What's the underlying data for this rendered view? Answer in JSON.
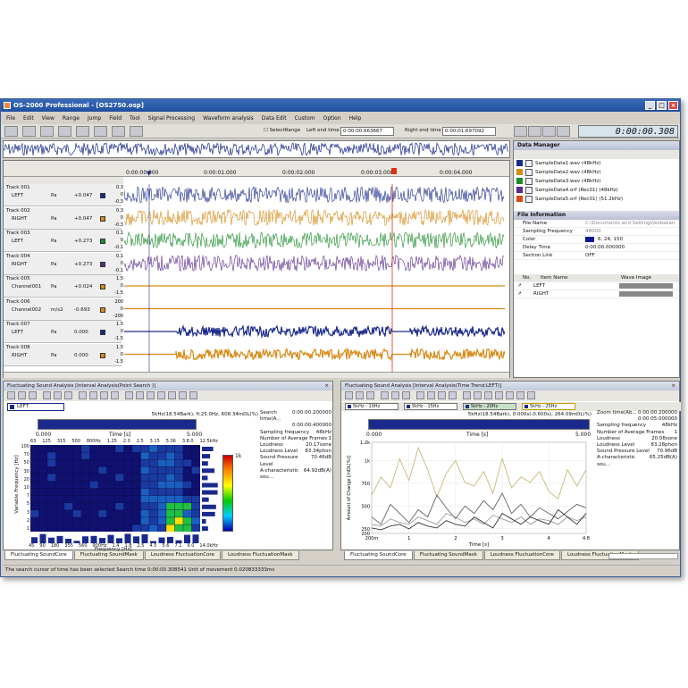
{
  "window": {
    "title": "OS-2000 Professional - [OS2750.osp]"
  },
  "menu": [
    "File",
    "Edit",
    "View",
    "Range",
    "Jump",
    "Field",
    "Tool",
    "Signal Processing",
    "Waveform analysis",
    "Data Edit",
    "Custom",
    "Option",
    "Help"
  ],
  "toolbar": {
    "select_range": "SelectRange",
    "left_end_label": "Left end time",
    "left_end_value": "0:00:00.663667",
    "right_end_label": "Right end time",
    "right_end_value": "0:00:01.697092",
    "clock": "0:00:00.308"
  },
  "timeline": {
    "ticks": [
      "0:00:00.000",
      "0:00:01.000",
      "0:00:02.000",
      "0:00:03.000",
      "0:00:04.000"
    ]
  },
  "tracks": [
    {
      "name": "Track 001",
      "channel": "LEFT",
      "unit": "Pa",
      "value": "+0.047",
      "color": "#1a2a8c",
      "scale": [
        "0.3",
        "0",
        "-0.3"
      ]
    },
    {
      "name": "Track 002",
      "channel": "RIGHT",
      "unit": "Pa",
      "value": "+0.047",
      "color": "#d88a14",
      "scale": [
        "0.3",
        "0",
        "-0.3"
      ]
    },
    {
      "name": "Track 003",
      "channel": "LEFT",
      "unit": "Pa",
      "value": "+0.273",
      "color": "#1a8c2a",
      "scale": [
        "0.1",
        "0",
        "-0.1"
      ]
    },
    {
      "name": "Track 004",
      "channel": "RIGHT",
      "unit": "Pa",
      "value": "+0.273",
      "color": "#5a2a8c",
      "scale": [
        "0.1",
        "0",
        "-0.1"
      ]
    },
    {
      "name": "Track 005",
      "channel": "Channel001",
      "unit": "Pa",
      "value": "+0.024",
      "color": "#d88a14",
      "scale": [
        "1.5",
        "0",
        "-1.5"
      ]
    },
    {
      "name": "Track 006",
      "channel": "Channel002",
      "unit": "m/s2",
      "value": "-0.693",
      "color": "#d88a14",
      "scale": [
        "200",
        "0",
        "-200"
      ]
    },
    {
      "name": "Track 007",
      "channel": "LEFT",
      "unit": "Pa",
      "value": "0.000",
      "color": "#1a2a8c",
      "scale": [
        "1.5",
        "0",
        "-1.5"
      ]
    },
    {
      "name": "Track 008",
      "channel": "RIGHT",
      "unit": "Pa",
      "value": "0.000",
      "color": "#d88a14",
      "scale": [
        "1.5",
        "0",
        "-1.5"
      ]
    }
  ],
  "data_manager": {
    "title": "Data Manager",
    "files": [
      {
        "name": "SampleData1.wav (48kHz)",
        "color": "#1a2a8c"
      },
      {
        "name": "SampleData2.wav (48kHz)",
        "color": "#d88a14"
      },
      {
        "name": "SampleData3.wav (48kHz)",
        "color": "#1a8c2a"
      },
      {
        "name": "SampleData4.orf (Rec01) (48kHz)",
        "color": "#5a2a8c"
      },
      {
        "name": "SampleData5.orf (Rec01) (51.2kHz)",
        "color": "#d84a14"
      }
    ],
    "file_info_title": "File Information",
    "props": [
      {
        "k": "File Name",
        "v": "C:\\Documents and Settings\\kobakan"
      },
      {
        "k": "Sampling Frequency",
        "v": "48000"
      },
      {
        "k": "Color",
        "v": "6, 24, 150"
      },
      {
        "k": "Delay Time",
        "v": "0:00:00.000000"
      },
      {
        "k": "Section Link",
        "v": "OFF"
      }
    ],
    "items_head": {
      "no": "No.",
      "item": "Item Name",
      "wave": "Wave Image"
    },
    "items": [
      "LEFT",
      "RIGHT"
    ]
  },
  "left_panel": {
    "title": "Fluctuating Sound Analysis [Interval Analysis(Point Search )]",
    "channel": "LEFT",
    "header_info": "5kHz(18.54Bark), fi:25.0Hz, 608.34mDL(%)",
    "time_ticks": [
      "0.000",
      "Time [s]",
      "5.000"
    ],
    "freq_top": [
      "63",
      "125",
      "315",
      "500",
      "800Hz",
      "1.25",
      "2.0",
      "2.5",
      "3.15",
      "5.06",
      "3.8.0",
      "12.5kHz"
    ],
    "freq_bottom": [
      "45",
      "90",
      "180",
      "355",
      "560",
      "900Hz",
      "1.4",
      "1.8",
      "2.5",
      "4.5",
      "5.6",
      "7.1",
      "9.0",
      "14.0kHz"
    ],
    "x_label": "Frequency [Hz]",
    "y_label": "Variable Frequency [Hz]",
    "y_ticks": [
      "100",
      "70",
      "50",
      "30",
      "20",
      "10",
      "7",
      "5",
      "3",
      "2",
      "1"
    ],
    "colorbar_top": "1k",
    "info": [
      {
        "k": "Search time(A...",
        "v": "0:00:00.200000"
      },
      {
        "k": "",
        "v": "0:00:00.400000"
      },
      {
        "k": "Sampling frequency",
        "v": "48kHz"
      },
      {
        "k": "Number of Average Frames",
        "v": "1"
      },
      {
        "k": "Loudness",
        "v": "20.17sone"
      },
      {
        "k": "Loudness Level",
        "v": "83.34phon"
      },
      {
        "k": "Sound Pressure Level",
        "v": "70.46dB"
      },
      {
        "k": "A-characteristic sou...",
        "v": "64.92dB(A)"
      }
    ],
    "tabs": [
      "Fluctuating SoundCore",
      "Fluctuating SoundMask",
      "Loudness FluctuationCore",
      "Loudness FluctuationMask"
    ]
  },
  "right_panel": {
    "title": "Fluctuating Sound Analysis [Interval Analysis(Time Trend:LEFT)]",
    "segments": [
      "5kHz - 10Hz",
      "5kHz - 15Hz",
      "5kHz - 20Hz",
      "5kHz - 25Hz"
    ],
    "header_info": "5kHz(18.54Bark), 0.000s(-0.600s), 264.09mDL(%)",
    "time_ticks": [
      "0.000",
      "Time [s]",
      "5.000"
    ],
    "y_label": "Amount of Change [mDL(%)]",
    "x_label": "Time [s]",
    "info": [
      {
        "k": "Zoom time(Ab...",
        "v": "0:00:00.200000"
      },
      {
        "k": "",
        "v": "0:00:05.000000"
      },
      {
        "k": "Sampling frequency",
        "v": "48kHz"
      },
      {
        "k": "Number of Average Frames",
        "v": "1"
      },
      {
        "k": "Loudness",
        "v": "20.08sone"
      },
      {
        "k": "Loudness Level",
        "v": "83.28phon"
      },
      {
        "k": "Sound Pressure Level",
        "v": "70.96dB"
      },
      {
        "k": "A-characteristic sou...",
        "v": "65.25dB(A)"
      }
    ],
    "tabs": [
      "Fluctuating SoundCore",
      "Fluctuating SoundMask",
      "Loudness FluctuationCore",
      "Loudness FluctuationMask"
    ]
  },
  "chart_data": {
    "type": "line",
    "xlabel": "Time [s]",
    "ylabel": "Amount of Change [mDL(%)]",
    "xlim": [
      0.2,
      4.8
    ],
    "ylim": [
      200,
      1200
    ],
    "x_ticks": [
      "200m",
      "1",
      "2",
      "3",
      "4",
      "4.8"
    ],
    "y_ticks": [
      "1.2k",
      "1k",
      "750",
      "500",
      "250",
      "200"
    ],
    "x": [
      0.2,
      0.4,
      0.6,
      0.8,
      1.0,
      1.2,
      1.4,
      1.6,
      1.8,
      2.0,
      2.2,
      2.4,
      2.6,
      2.8,
      3.0,
      3.2,
      3.4,
      3.6,
      3.8,
      4.0,
      4.2,
      4.4,
      4.6,
      4.8
    ],
    "series": [
      {
        "color": "#c8b878",
        "values": [
          620,
          820,
          700,
          1020,
          780,
          1140,
          900,
          600,
          860,
          1000,
          760,
          720,
          880,
          640,
          1020,
          700,
          820,
          760,
          880,
          660,
          580,
          900,
          720,
          900
        ]
      },
      {
        "color": "#666666",
        "values": [
          380,
          300,
          520,
          420,
          320,
          460,
          380,
          620,
          480,
          360,
          500,
          420,
          560,
          460,
          640,
          420,
          520,
          380,
          480,
          420,
          360,
          440,
          520,
          480
        ]
      },
      {
        "color": "#999999",
        "values": [
          300,
          280,
          360,
          320,
          300,
          380,
          340,
          300,
          420,
          380,
          320,
          360,
          300,
          400,
          360,
          320,
          380,
          300,
          360,
          340,
          300,
          380,
          340,
          380
        ]
      },
      {
        "color": "#333333",
        "values": [
          260,
          240,
          280,
          300,
          250,
          320,
          280,
          260,
          340,
          300,
          280,
          380,
          320,
          260,
          420,
          360,
          300,
          380,
          340,
          300,
          460,
          380,
          300,
          420
        ]
      }
    ]
  },
  "status": {
    "text": "The search cursor of time has been selected  Search time 0:00:00.308541 Unit of movement 0.020833333ms"
  }
}
